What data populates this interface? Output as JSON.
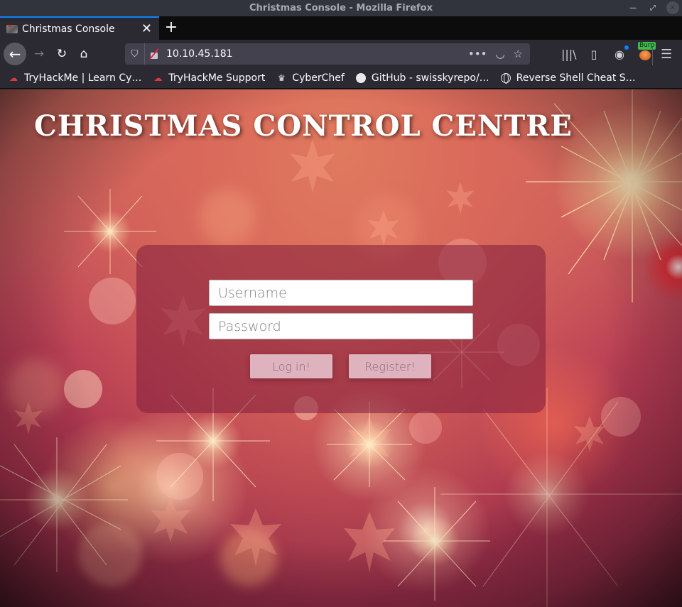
{
  "window": {
    "title": "Christmas Console - Mozilla Firefox",
    "controls": {
      "minimize": "minimize-icon",
      "maximize": "maximize-icon",
      "close": "close-icon"
    }
  },
  "tabs": [
    {
      "label": "Christmas Console",
      "active": true,
      "favicon": "christmas-console-favicon"
    }
  ],
  "tab_controls": {
    "close_glyph": "✕",
    "new_tab_glyph": "+"
  },
  "navbar": {
    "back_glyph": "←",
    "forward_glyph": "→",
    "reload_glyph": "↻",
    "home_glyph": "⌂",
    "url": "10.10.45.181",
    "url_actions": {
      "more_glyph": "•••",
      "pocket_glyph": "◡",
      "bookmark_glyph": "☆"
    },
    "toolbar": {
      "library_glyph": "|||\\",
      "sidebar_glyph": "▯",
      "account_glyph": "◉",
      "burp_badge": "Burp",
      "menu_glyph": "☰"
    }
  },
  "bookmarks": [
    {
      "label": "TryHackMe | Learn Cy…",
      "icon": "tryhackme-cloud-icon"
    },
    {
      "label": "TryHackMe Support",
      "icon": "tryhackme-cloud-icon"
    },
    {
      "label": "CyberChef",
      "icon": "chef-hat-icon"
    },
    {
      "label": "GitHub - swisskyrepo/…",
      "icon": "github-icon"
    },
    {
      "label": "Reverse Shell Cheat S…",
      "icon": "globe-icon"
    }
  ],
  "page": {
    "title": "CHRISTMAS CONTROL CENTRE",
    "login": {
      "username_placeholder": "Username",
      "username_value": "",
      "password_placeholder": "Password",
      "password_value": "",
      "login_label": "Log in!",
      "register_label": "Register!"
    }
  },
  "colors": {
    "tab_accent": "#0a84ff",
    "chrome_bg": "#2b2a33",
    "titlebar_bg": "#31343d",
    "burp_badge": "#3fb950",
    "insecure_slash": "#e22850",
    "tryhackme_red": "#e0383b"
  }
}
